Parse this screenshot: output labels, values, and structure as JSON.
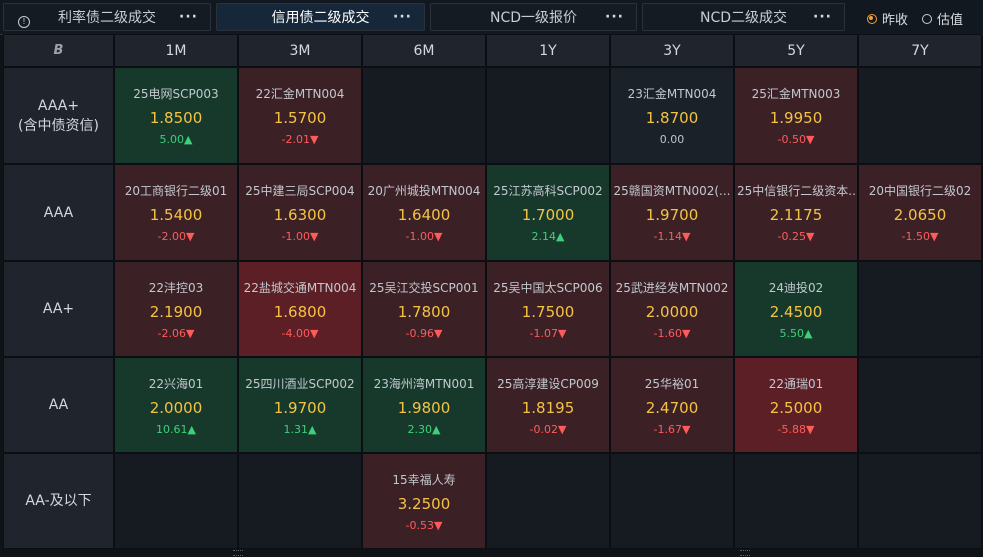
{
  "tabs": [
    {
      "label": "利率债二级成交",
      "active": false
    },
    {
      "label": "信用债二级成交",
      "active": true
    },
    {
      "label": "NCD一级报价",
      "active": false
    },
    {
      "label": "NCD二级成交",
      "active": false
    }
  ],
  "more_label": "···",
  "radio": {
    "prev_close": "昨收",
    "valuation": "估值"
  },
  "corner_logo": "B",
  "columns": [
    "1M",
    "3M",
    "6M",
    "1Y",
    "3Y",
    "5Y",
    "7Y"
  ],
  "rows": [
    {
      "label_line1": "AAA+",
      "label_line2": "(含中债资信)",
      "cells": [
        {
          "name": "25电网SCP003",
          "yield": "1.8500",
          "change": "5.00▲",
          "dir": "up"
        },
        {
          "name": "22汇金MTN004",
          "yield": "1.5700",
          "change": "-2.01▼",
          "dir": "down"
        },
        null,
        null,
        {
          "name": "23汇金MTN004",
          "yield": "1.8700",
          "change": "0.00",
          "dir": "flat"
        },
        {
          "name": "25汇金MTN003",
          "yield": "1.9950",
          "change": "-0.50▼",
          "dir": "down"
        },
        null
      ]
    },
    {
      "label_line1": "AAA",
      "label_line2": "",
      "cells": [
        {
          "name": "20工商银行二级01",
          "yield": "1.5400",
          "change": "-2.00▼",
          "dir": "down"
        },
        {
          "name": "25中建三局SCP004",
          "yield": "1.6300",
          "change": "-1.00▼",
          "dir": "down"
        },
        {
          "name": "20广州城投MTN004",
          "yield": "1.6400",
          "change": "-1.00▼",
          "dir": "down"
        },
        {
          "name": "25江苏高科SCP002",
          "yield": "1.7000",
          "change": "2.14▲",
          "dir": "up"
        },
        {
          "name": "25赣国资MTN002(...",
          "yield": "1.9700",
          "change": "-1.14▼",
          "dir": "down"
        },
        {
          "name": "25中信银行二级资本...",
          "yield": "2.1175",
          "change": "-0.25▼",
          "dir": "down"
        },
        {
          "name": "20中国银行二级02",
          "yield": "2.0650",
          "change": "-1.50▼",
          "dir": "down"
        }
      ]
    },
    {
      "label_line1": "AA+",
      "label_line2": "",
      "cells": [
        {
          "name": "22沣控03",
          "yield": "2.1900",
          "change": "-2.06▼",
          "dir": "down"
        },
        {
          "name": "22盐城交通MTN004",
          "yield": "1.6800",
          "change": "-4.00▼",
          "dir": "down-strong"
        },
        {
          "name": "25吴江交投SCP001",
          "yield": "1.7800",
          "change": "-0.96▼",
          "dir": "down"
        },
        {
          "name": "25吴中国太SCP006",
          "yield": "1.7500",
          "change": "-1.07▼",
          "dir": "down"
        },
        {
          "name": "25武进经发MTN002",
          "yield": "2.0000",
          "change": "-1.60▼",
          "dir": "down"
        },
        {
          "name": "24迪投02",
          "yield": "2.4500",
          "change": "5.50▲",
          "dir": "up"
        },
        null
      ]
    },
    {
      "label_line1": "AA",
      "label_line2": "",
      "cells": [
        {
          "name": "22兴海01",
          "yield": "2.0000",
          "change": "10.61▲",
          "dir": "up"
        },
        {
          "name": "25四川酒业SCP002",
          "yield": "1.9700",
          "change": "1.31▲",
          "dir": "up"
        },
        {
          "name": "23海州湾MTN001",
          "yield": "1.9800",
          "change": "2.30▲",
          "dir": "up"
        },
        {
          "name": "25高淳建设CP009",
          "yield": "1.8195",
          "change": "-0.02▼",
          "dir": "down"
        },
        {
          "name": "25华裕01",
          "yield": "2.4700",
          "change": "-1.67▼",
          "dir": "down"
        },
        {
          "name": "22通瑞01",
          "yield": "2.5000",
          "change": "-5.88▼",
          "dir": "down-strong"
        },
        null
      ]
    },
    {
      "label_line1": "AA-及以下",
      "label_line2": "",
      "cells": [
        null,
        null,
        {
          "name": "15幸福人寿",
          "yield": "3.2500",
          "change": "-0.53▼",
          "dir": "down"
        },
        null,
        null,
        null,
        null
      ]
    }
  ]
}
